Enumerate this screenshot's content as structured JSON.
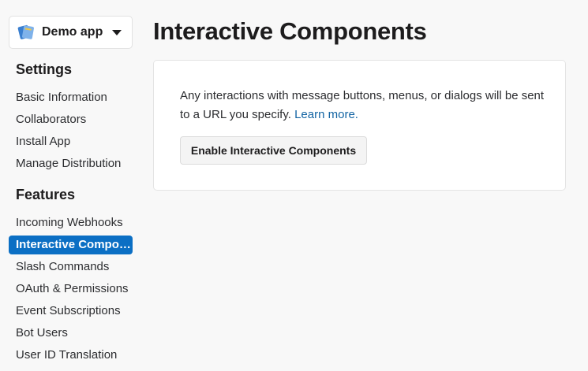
{
  "app_switcher": {
    "name": "Demo app"
  },
  "sidebar": {
    "settings_title": "Settings",
    "settings_items": [
      {
        "label": "Basic Information"
      },
      {
        "label": "Collaborators"
      },
      {
        "label": "Install App"
      },
      {
        "label": "Manage Distribution"
      }
    ],
    "features_title": "Features",
    "features_items": [
      {
        "label": "Incoming Webhooks"
      },
      {
        "label": "Interactive Components",
        "active": true
      },
      {
        "label": "Slash Commands"
      },
      {
        "label": "OAuth & Permissions"
      },
      {
        "label": "Event Subscriptions"
      },
      {
        "label": "Bot Users"
      },
      {
        "label": "User ID Translation"
      }
    ]
  },
  "main": {
    "title": "Interactive Components",
    "card": {
      "description": "Any interactions with message buttons, menus, or dialogs will be sent to a URL you specify.",
      "learn_more": "Learn more.",
      "button_label": "Enable Interactive Components"
    }
  },
  "colors": {
    "accent": "#0b6fc4",
    "link": "#1264a3",
    "background": "#f8f8f8"
  }
}
